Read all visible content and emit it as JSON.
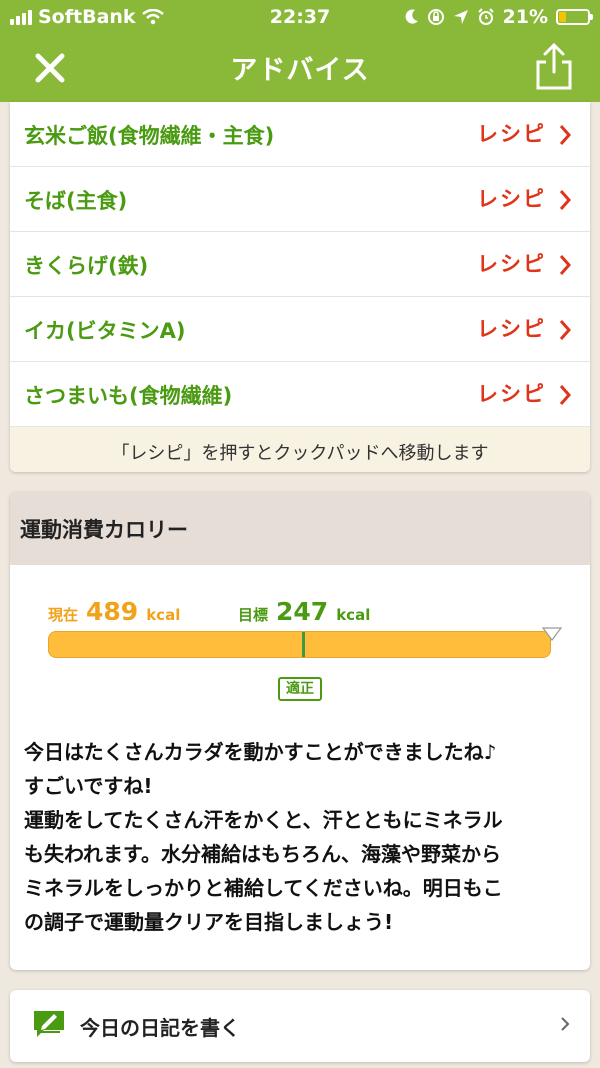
{
  "status_bar": {
    "carrier": "SoftBank",
    "time": "22:37",
    "battery": "21%",
    "icons": [
      "signal-icon",
      "wifi-icon",
      "moon-icon",
      "orientation-lock-icon",
      "location-icon",
      "alarm-icon",
      "battery-icon"
    ]
  },
  "nav": {
    "title": "アドバイス",
    "close_icon": "close-icon",
    "share_icon": "share-icon"
  },
  "recipes": {
    "items": [
      {
        "name": "玄米ご飯(食物繊維・主食)",
        "link": "レシピ"
      },
      {
        "name": "そば(主食)",
        "link": "レシピ"
      },
      {
        "name": "きくらげ(鉄)",
        "link": "レシピ"
      },
      {
        "name": "イカ(ビタミンA)",
        "link": "レシピ"
      },
      {
        "name": "さつまいも(食物繊維)",
        "link": "レシピ"
      }
    ],
    "note": "「レシピ」を押すとクックパッドへ移動します"
  },
  "calories": {
    "title": "運動消費カロリー",
    "current_label": "現在",
    "current_value": "489",
    "current_unit": "kcal",
    "target_label": "目標",
    "target_value": "247",
    "target_unit": "kcal",
    "target_fraction": 0.505,
    "badge": "適正",
    "message_lines": [
      "今日はたくさんカラダを動かすことができましたね♪",
      "すごいですね!",
      "運動をしてたくさん汗をかくと、汗とともにミネラル",
      "も失われます。水分補給はもちろん、海藻や野菜から",
      "ミネラルをしっかりと補給してくださいね。明日もこ",
      "の調子で運動量クリアを目指しましょう!"
    ]
  },
  "diary": {
    "label": "今日の日記を書く"
  },
  "colors": {
    "header_green": "#8ab93a",
    "text_green": "#4a9a12",
    "link_red": "#e0341a",
    "bar_orange": "#ffbd3b",
    "current_orange": "#f0a21a"
  }
}
